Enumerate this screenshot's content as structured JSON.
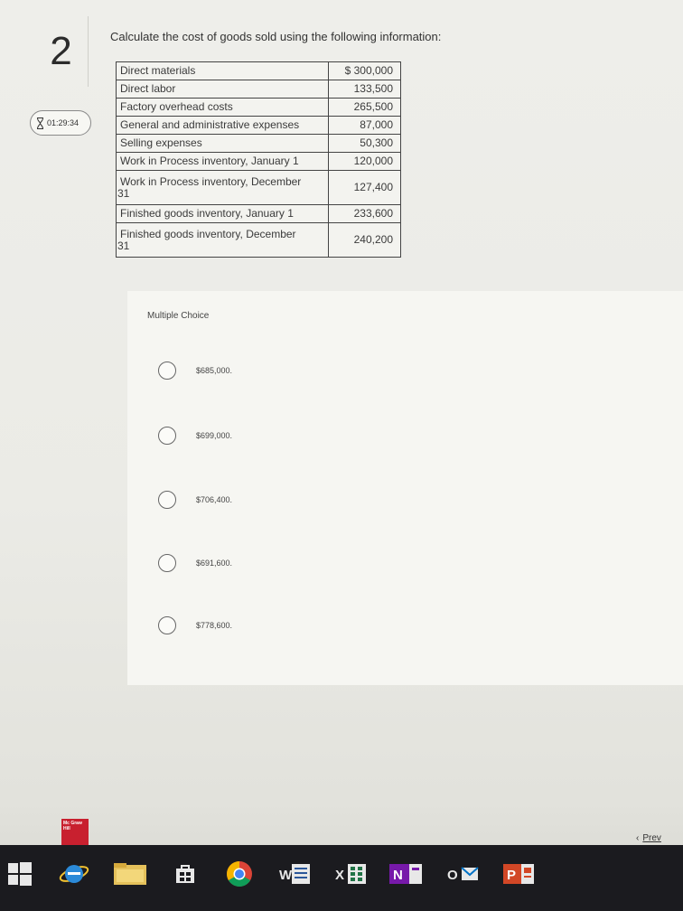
{
  "question": {
    "number": "2",
    "timer": "01:29:34",
    "prompt": "Calculate the cost of goods sold using the following information:"
  },
  "table": {
    "rows": [
      {
        "label": "Direct materials",
        "value": "$ 300,000"
      },
      {
        "label": "Direct labor",
        "value": "133,500"
      },
      {
        "label": "Factory overhead costs",
        "value": "265,500"
      },
      {
        "label": "General and administrative expenses",
        "value": "87,000"
      },
      {
        "label": "Selling expenses",
        "value": "50,300"
      },
      {
        "label": "Work in Process inventory, January 1",
        "value": "120,000"
      },
      {
        "label": "Work in Process inventory, December",
        "label2": "31",
        "value": "127,400"
      },
      {
        "label": "Finished goods inventory, January 1",
        "value": "233,600"
      },
      {
        "label": "Finished goods inventory, December",
        "label2": "31",
        "value": "240,200"
      }
    ]
  },
  "multiple_choice": {
    "title": "Multiple Choice",
    "options": [
      "$685,000.",
      "$699,000.",
      "$706,400.",
      "$691,600.",
      "$778,600."
    ]
  },
  "logo": {
    "text": "Mc Graw Hill"
  },
  "nav": {
    "prev_label": "Prev",
    "prev_glyph": "‹"
  },
  "taskbar": {
    "word_label": "W",
    "excel_label": "X",
    "onenote_label": "N",
    "outlook_label": "O",
    "powerpoint_label": "P"
  },
  "colors": {
    "word": "#2b579a",
    "excel": "#217346",
    "onenote": "#7719aa",
    "outlook": "#0072c6",
    "powerpoint": "#d24726",
    "logo": "#c8202f"
  }
}
